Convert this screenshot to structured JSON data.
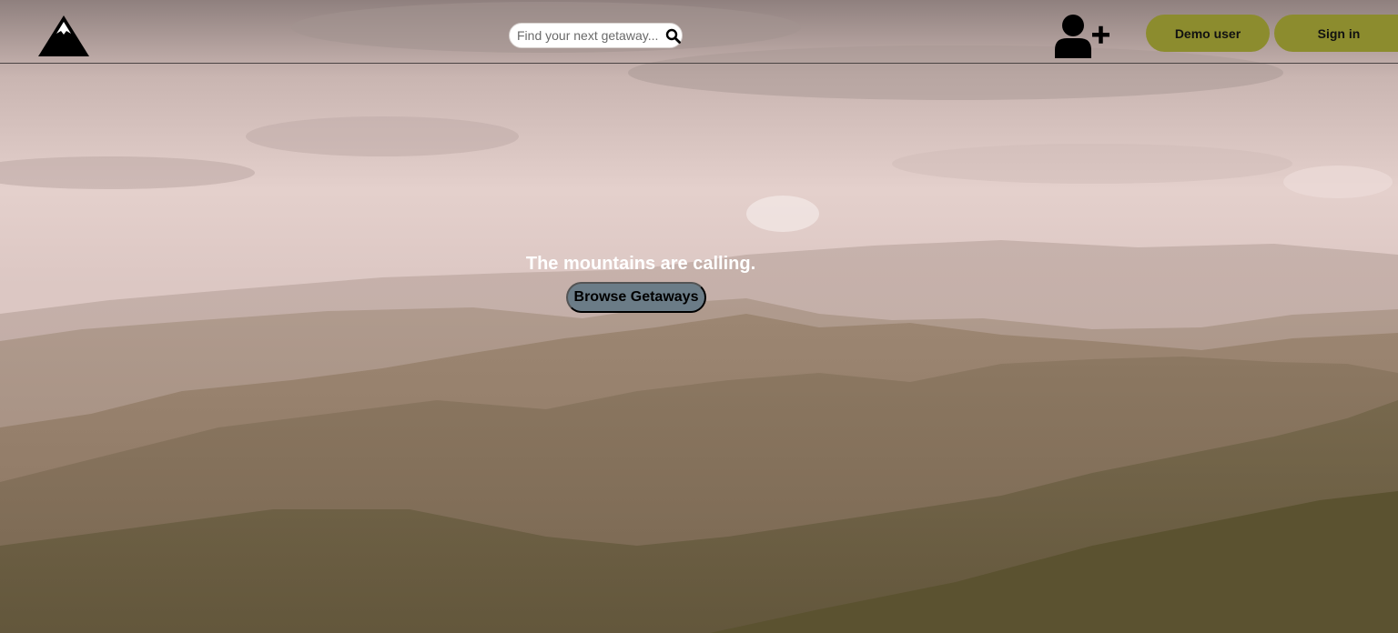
{
  "header": {
    "logo_icon": "mountain-icon",
    "search": {
      "placeholder": "Find your next getaway...",
      "value": "",
      "icon": "search-icon"
    },
    "signup_icon": "user-plus-icon",
    "demo_user_label": "Demo user",
    "sign_in_label": "Sign in",
    "button_color": "#8c8c2e"
  },
  "hero": {
    "tagline": "The mountains are calling.",
    "browse_label": "Browse Getaways",
    "browse_color": "#6b7c87"
  }
}
